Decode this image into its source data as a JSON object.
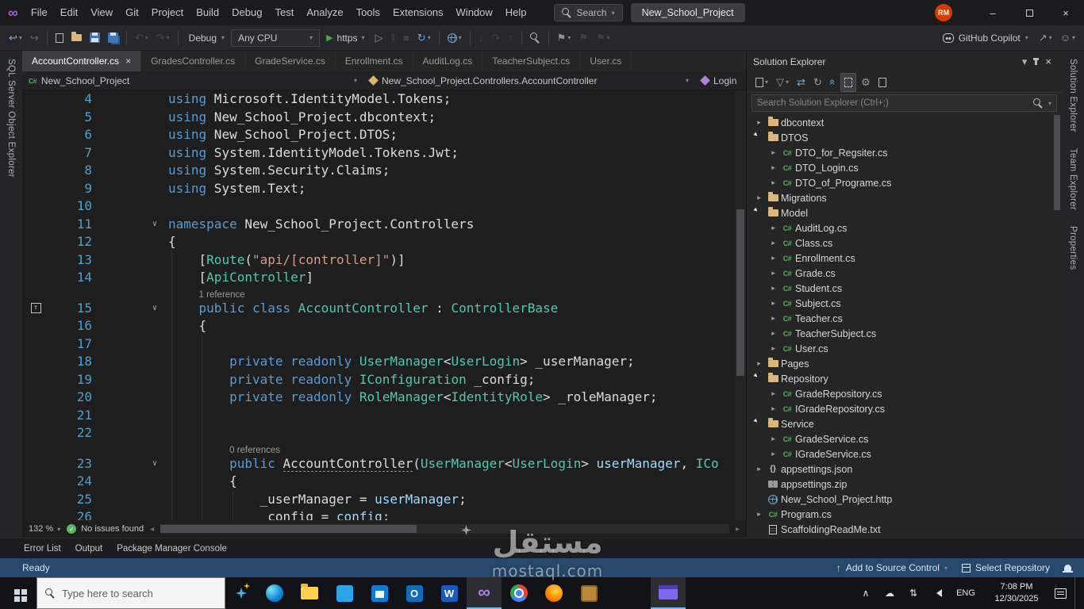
{
  "colors": {
    "accent_blue": "#007acc",
    "keyword": "#569cd6",
    "type_teal": "#4ec9b0",
    "string_orange": "#d69d85",
    "status_bar": "#25486b",
    "folder_yellow": "#dcb67a"
  },
  "titlebar": {
    "menus": [
      "File",
      "Edit",
      "View",
      "Git",
      "Project",
      "Build",
      "Debug",
      "Test",
      "Analyze",
      "Tools",
      "Extensions",
      "Window",
      "Help"
    ],
    "search_label": "Search",
    "solution": "New_School_Project",
    "avatar": "RM",
    "minimize": "–",
    "close": "×"
  },
  "toolbar": {
    "config": "Debug",
    "platform": "Any CPU",
    "run": "https",
    "copilot": "GitHub Copilot",
    "icons_left": [
      {
        "name": "navigate-backward-icon",
        "glyph": "↩",
        "color": "#7ca9d6",
        "dd": true
      },
      {
        "name": "navigate-forward-icon",
        "glyph": "↪",
        "color": "#6b6b6b"
      },
      {
        "sep": true
      },
      {
        "name": "new-file-icon",
        "shape": "page"
      },
      {
        "name": "open-folder-icon",
        "shape": "folder"
      },
      {
        "name": "save-icon",
        "shape": "floppy"
      },
      {
        "name": "save-all-icon",
        "shape": "floppy2"
      },
      {
        "sep": true
      },
      {
        "name": "undo-icon",
        "glyph": "↶",
        "color": "#6b6b6b",
        "dd": true,
        "disabled": true
      },
      {
        "name": "redo-icon",
        "glyph": "↷",
        "color": "#6b6b6b",
        "dd": true,
        "disabled": true
      },
      {
        "sep": true
      }
    ],
    "icons_mid": [
      {
        "name": "run-without-debugging-icon",
        "glyph": "▷",
        "color": "#8f8f8f"
      },
      {
        "name": "break-all-icon",
        "glyph": "‖",
        "color": "#5f5f5f",
        "disabled": true
      },
      {
        "name": "stop-icon",
        "glyph": "■",
        "color": "#5f5f5f",
        "disabled": true
      },
      {
        "name": "restart-icon",
        "glyph": "↻",
        "color": "#64a6dd",
        "dd": true
      },
      {
        "sep": true
      },
      {
        "name": "browser-link-icon",
        "shape": "globe",
        "dd": true
      },
      {
        "sep": true
      },
      {
        "name": "step-into-icon",
        "glyph": "↓",
        "color": "#5f5f5f",
        "disabled": true
      },
      {
        "name": "step-over-icon",
        "glyph": "↷",
        "color": "#5f5f5f",
        "disabled": true
      },
      {
        "name": "step-out-icon",
        "glyph": "↑",
        "color": "#5f5f5f",
        "disabled": true
      },
      {
        "sep": true
      },
      {
        "name": "find-in-files-icon",
        "shape": "mag"
      },
      {
        "sep": true
      },
      {
        "name": "bookmark-icon",
        "glyph": "⚑",
        "color": "#8f8f8f",
        "dd": true
      },
      {
        "name": "previous-bookmark-icon",
        "glyph": "⚑",
        "color": "#5f5f5f",
        "disabled": true
      },
      {
        "name": "next-bookmark-icon",
        "glyph": "⚑",
        "color": "#5f5f5f",
        "disabled": true,
        "dd": true
      }
    ],
    "icons_right": [
      {
        "name": "live-share-icon",
        "glyph": "↗",
        "color": "#9a9a9a",
        "dd": true
      },
      {
        "name": "send-feedback-icon",
        "glyph": "☺",
        "color": "#9a9a9a",
        "dd": true
      }
    ]
  },
  "strips": {
    "left": "SQL Server Object Explorer",
    "right": [
      "Solution Explorer",
      "Team Explorer",
      "Properties"
    ]
  },
  "tabs": [
    {
      "label": "AccountController.cs",
      "active": true
    },
    {
      "label": "GradesController.cs"
    },
    {
      "label": "GradeService.cs"
    },
    {
      "label": "Enrollment.cs"
    },
    {
      "label": "AuditLog.cs"
    },
    {
      "label": "TeacherSubject.cs"
    },
    {
      "label": "User.cs"
    }
  ],
  "breadcrumb": {
    "project": "New_School_Project",
    "type": "New_School_Project.Controllers.AccountController",
    "member": "Login"
  },
  "editor": {
    "zoom": "132 %",
    "health": "No issues found",
    "rows": [
      {
        "n": "4",
        "t": [
          [
            "k",
            "using"
          ],
          [
            "p",
            " Microsoft.IdentityModel.Tokens;"
          ]
        ]
      },
      {
        "n": "5",
        "t": [
          [
            "k",
            "using"
          ],
          [
            "p",
            " New_School_Project.dbcontext;"
          ]
        ]
      },
      {
        "n": "6",
        "t": [
          [
            "k",
            "using"
          ],
          [
            "p",
            " New_School_Project.DTOS;"
          ]
        ]
      },
      {
        "n": "7",
        "t": [
          [
            "k",
            "using"
          ],
          [
            "p",
            " System.IdentityModel.Tokens.Jwt;"
          ]
        ]
      },
      {
        "n": "8",
        "t": [
          [
            "k",
            "using"
          ],
          [
            "p",
            " System.Security.Claims;"
          ]
        ]
      },
      {
        "n": "9",
        "t": [
          [
            "k",
            "using"
          ],
          [
            "p",
            " System.Text;"
          ]
        ]
      },
      {
        "n": "10",
        "t": []
      },
      {
        "n": "11",
        "fold": true,
        "t": [
          [
            "k",
            "namespace"
          ],
          [
            "p",
            " New_School_Project.Controllers"
          ]
        ]
      },
      {
        "n": "12",
        "t": [
          [
            "p",
            "{"
          ]
        ]
      },
      {
        "n": "13",
        "t": [
          [
            "p",
            "    ["
          ],
          [
            "ty",
            "Route"
          ],
          [
            "p",
            "("
          ],
          [
            "s",
            "\"api/[controller]\""
          ],
          [
            "p",
            ")]"
          ]
        ]
      },
      {
        "n": "14",
        "t": [
          [
            "p",
            "    ["
          ],
          [
            "ty",
            "ApiController"
          ],
          [
            "p",
            "]"
          ]
        ]
      },
      {
        "lens": "1 reference",
        "ind": "    "
      },
      {
        "n": "15",
        "fold": true,
        "icon": true,
        "t": [
          [
            "p",
            "    "
          ],
          [
            "k",
            "public"
          ],
          [
            "p",
            " "
          ],
          [
            "k",
            "class"
          ],
          [
            "p",
            " "
          ],
          [
            "ty",
            "AccountController"
          ],
          [
            "p",
            " : "
          ],
          [
            "ty",
            "ControllerBase"
          ]
        ]
      },
      {
        "n": "16",
        "t": [
          [
            "p",
            "    {"
          ]
        ]
      },
      {
        "n": "17",
        "t": []
      },
      {
        "n": "18",
        "t": [
          [
            "p",
            "        "
          ],
          [
            "k",
            "private"
          ],
          [
            "p",
            " "
          ],
          [
            "k",
            "readonly"
          ],
          [
            "p",
            " "
          ],
          [
            "ty",
            "UserManager"
          ],
          [
            "p",
            "<"
          ],
          [
            "ty",
            "UserLogin"
          ],
          [
            "p",
            "> _userManager;"
          ]
        ]
      },
      {
        "n": "19",
        "t": [
          [
            "p",
            "        "
          ],
          [
            "k",
            "private"
          ],
          [
            "p",
            " "
          ],
          [
            "k",
            "readonly"
          ],
          [
            "p",
            " "
          ],
          [
            "ty",
            "IConfiguration"
          ],
          [
            "p",
            " _config;"
          ]
        ]
      },
      {
        "n": "20",
        "t": [
          [
            "p",
            "        "
          ],
          [
            "k",
            "private"
          ],
          [
            "p",
            " "
          ],
          [
            "k",
            "readonly"
          ],
          [
            "p",
            " "
          ],
          [
            "ty",
            "RoleManager"
          ],
          [
            "p",
            "<"
          ],
          [
            "ty",
            "IdentityRole"
          ],
          [
            "p",
            "> _roleManager;"
          ]
        ]
      },
      {
        "n": "21",
        "t": []
      },
      {
        "n": "22",
        "t": []
      },
      {
        "lens": "0 references",
        "ind": "        "
      },
      {
        "n": "23",
        "fold": true,
        "t": [
          [
            "p",
            "        "
          ],
          [
            "k",
            "public"
          ],
          [
            "p",
            " "
          ],
          [
            "u",
            "AccountController"
          ],
          [
            "p",
            "("
          ],
          [
            "ty",
            "UserManager"
          ],
          [
            "p",
            "<"
          ],
          [
            "ty",
            "UserLogin"
          ],
          [
            "p",
            "> "
          ],
          [
            "v",
            "userManager"
          ],
          [
            "p",
            ", "
          ],
          [
            "ty",
            "ICo"
          ]
        ]
      },
      {
        "n": "24",
        "t": [
          [
            "p",
            "        {"
          ]
        ]
      },
      {
        "n": "25",
        "t": [
          [
            "p",
            "            _userManager = "
          ],
          [
            "v",
            "userManager"
          ],
          [
            "p",
            ";"
          ]
        ]
      },
      {
        "n": "26",
        "t": [
          [
            "p",
            "            _config = "
          ],
          [
            "v",
            "config"
          ],
          [
            "p",
            ";"
          ]
        ]
      }
    ]
  },
  "solution_explorer": {
    "title": "Solution Explorer",
    "search_placeholder": "Search Solution Explorer (Ctrl+;)",
    "header_icons": [
      {
        "name": "toolwindow-menu-icon",
        "glyph": "▾",
        "color": "#b0b0b0"
      },
      {
        "name": "pin-icon",
        "shape": "pin"
      },
      {
        "name": "close-icon",
        "glyph": "×",
        "color": "#d0d0d0"
      }
    ],
    "toolbar_icons": [
      {
        "name": "switch-views-icon",
        "shape": "page",
        "dd": true
      },
      {
        "name": "pending-changes-filter-icon",
        "glyph": "▽",
        "color": "#9a9a9a",
        "dd": true
      },
      {
        "name": "sync-with-active-document-icon",
        "glyph": "⇄",
        "color": "#7ca9d6"
      },
      {
        "name": "refresh-icon",
        "glyph": "↻",
        "color": "#9a9a9a"
      },
      {
        "name": "collapse-all-icon",
        "glyph": "«",
        "rot": 90,
        "color": "#7ca9d6"
      },
      {
        "name": "show-all-files-icon",
        "shape": "page2",
        "active": true
      },
      {
        "name": "properties-icon",
        "glyph": "⚙",
        "color": "#9a9a9a"
      },
      {
        "name": "preview-selected-icon",
        "shape": "page"
      }
    ],
    "items": [
      {
        "label": "dbcontext",
        "kind": "folder",
        "state": "collapsed",
        "depth": 0
      },
      {
        "label": "DTOS",
        "kind": "folder",
        "state": "expanded",
        "depth": 0
      },
      {
        "label": "DTO_for_Regsiter.cs",
        "kind": "cs",
        "state": "collapsed",
        "depth": 1
      },
      {
        "label": "DTO_Login.cs",
        "kind": "cs",
        "state": "collapsed",
        "depth": 1
      },
      {
        "label": "DTO_of_Programe.cs",
        "kind": "cs",
        "state": "collapsed",
        "depth": 1
      },
      {
        "label": "Migrations",
        "kind": "folder",
        "state": "collapsed",
        "depth": 0
      },
      {
        "label": "Model",
        "kind": "folder",
        "state": "expanded",
        "depth": 0
      },
      {
        "label": "AuditLog.cs",
        "kind": "cs",
        "state": "collapsed",
        "depth": 1
      },
      {
        "label": "Class.cs",
        "kind": "cs",
        "state": "collapsed",
        "depth": 1
      },
      {
        "label": "Enrollment.cs",
        "kind": "cs",
        "state": "collapsed",
        "depth": 1
      },
      {
        "label": "Grade.cs",
        "kind": "cs",
        "state": "collapsed",
        "depth": 1
      },
      {
        "label": "Student.cs",
        "kind": "cs",
        "state": "collapsed",
        "depth": 1
      },
      {
        "label": "Subject.cs",
        "kind": "cs",
        "state": "collapsed",
        "depth": 1
      },
      {
        "label": "Teacher.cs",
        "kind": "cs",
        "state": "collapsed",
        "depth": 1
      },
      {
        "label": "TeacherSubject.cs",
        "kind": "cs",
        "state": "collapsed",
        "depth": 1
      },
      {
        "label": "User.cs",
        "kind": "cs",
        "state": "collapsed",
        "depth": 1
      },
      {
        "label": "Pages",
        "kind": "folder",
        "state": "collapsed",
        "depth": 0
      },
      {
        "label": "Repository",
        "kind": "folder",
        "state": "expanded",
        "depth": 0
      },
      {
        "label": "GradeRepository.cs",
        "kind": "cs",
        "state": "collapsed",
        "depth": 1
      },
      {
        "label": "IGradeRepository.cs",
        "kind": "cs",
        "state": "collapsed",
        "depth": 1
      },
      {
        "label": "Service",
        "kind": "folder",
        "state": "expanded",
        "depth": 0
      },
      {
        "label": "GradeService.cs",
        "kind": "cs",
        "state": "collapsed",
        "depth": 1
      },
      {
        "label": "IGradeService.cs",
        "kind": "cs",
        "state": "collapsed",
        "depth": 1
      },
      {
        "label": "appsettings.json",
        "kind": "json",
        "state": "collapsed",
        "depth": 0
      },
      {
        "label": "appsettings.zip",
        "kind": "zip",
        "state": "none",
        "depth": 0
      },
      {
        "label": "New_School_Project.http",
        "kind": "http",
        "state": "none",
        "depth": 0
      },
      {
        "label": "Program.cs",
        "kind": "cs",
        "state": "collapsed",
        "depth": 0
      },
      {
        "label": "ScaffoldingReadMe.txt",
        "kind": "txt",
        "state": "none",
        "depth": 0
      }
    ]
  },
  "bottom_panel": {
    "tabs": [
      "Error List",
      "Output",
      "Package Manager Console"
    ]
  },
  "statusbar": {
    "ready": "Ready",
    "add_source": "Add to Source Control",
    "select_repo": "Select Repository"
  },
  "taskbar": {
    "search_placeholder": "Type here to search",
    "lang": "ENG",
    "time": "7:08 PM",
    "date": "12/30/2025",
    "apps": [
      {
        "name": "edge-icon",
        "kind": "edge"
      },
      {
        "name": "file-explorer-icon",
        "kind": "folder"
      },
      {
        "name": "vs-code-icon",
        "kind": "vscode"
      },
      {
        "name": "store-icon",
        "kind": "store"
      },
      {
        "name": "outlook-icon",
        "kind": "outlook",
        "glyph": "O"
      },
      {
        "name": "word-icon",
        "kind": "word",
        "glyph": "W"
      },
      {
        "name": "visual-studio-icon",
        "kind": "vs",
        "glyph": "∞",
        "active": true
      },
      {
        "name": "chrome-icon",
        "kind": "chrome"
      },
      {
        "name": "firefox-icon",
        "kind": "firefox"
      },
      {
        "name": "ssms-icon",
        "kind": "ssms"
      },
      {
        "name": "app-window-icon",
        "kind": "vm",
        "active": true,
        "gap": true
      }
    ],
    "tray": [
      {
        "name": "hidden-icons-chevron",
        "glyph": "∧"
      },
      {
        "name": "onedrive-icon",
        "glyph": "☁"
      },
      {
        "name": "network-icon",
        "glyph": "⇅"
      },
      {
        "name": "volume-icon",
        "shape": "spk"
      }
    ]
  },
  "watermark": {
    "arabic": "مستقل",
    "latin": "mostaql.com"
  }
}
